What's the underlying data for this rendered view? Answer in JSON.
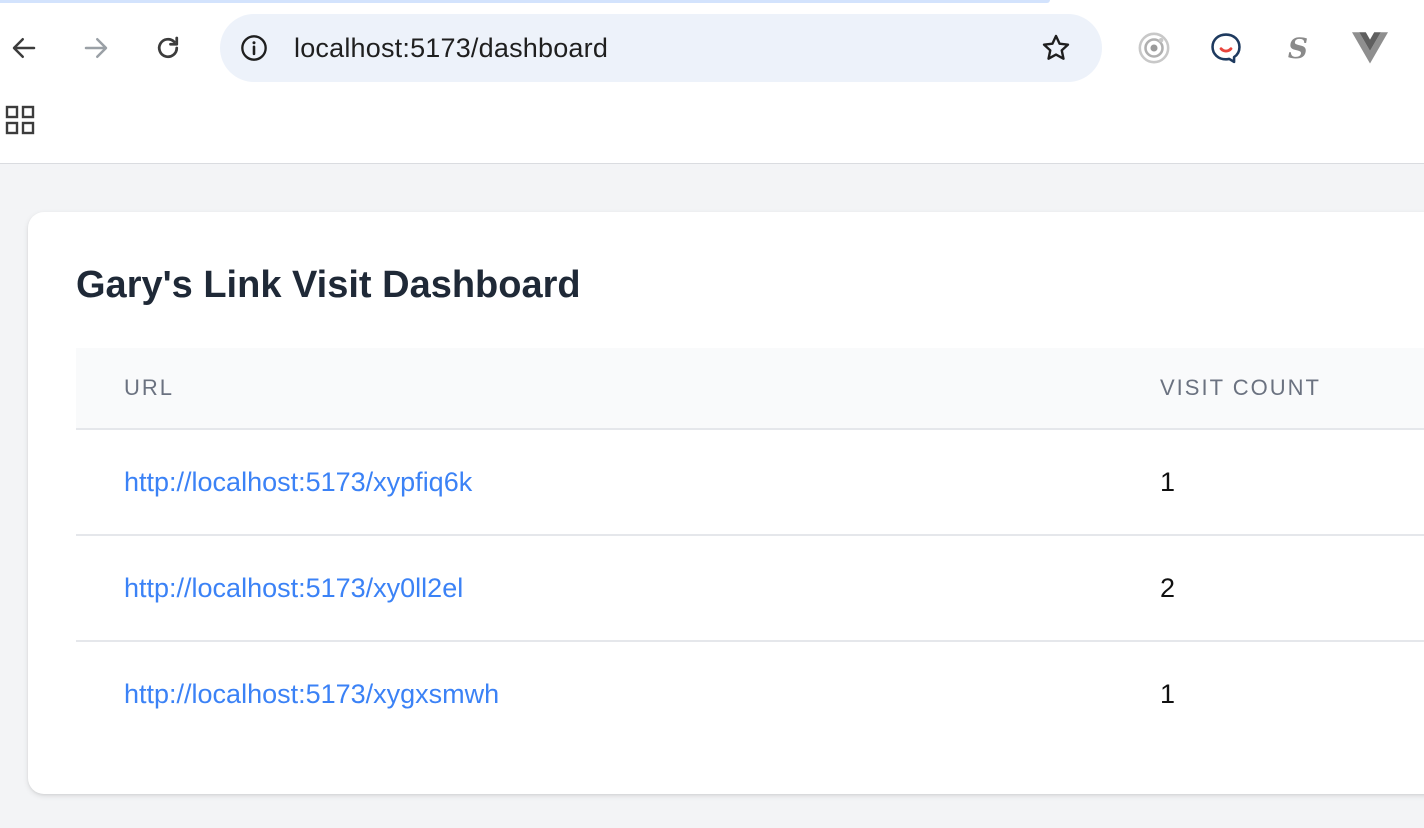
{
  "browser": {
    "url": "localhost:5173/dashboard",
    "icons": {
      "back": "back-arrow-icon",
      "forward": "forward-arrow-icon",
      "reload": "reload-icon",
      "site_info": "info-icon",
      "bookmark": "star-icon",
      "apps": "apps-grid-icon"
    },
    "extensions": [
      {
        "icon": "target-icon"
      },
      {
        "icon": "chat-bubble-icon"
      },
      {
        "icon": "s-letter-icon",
        "label": "S"
      },
      {
        "icon": "vue-devtools-icon"
      }
    ]
  },
  "page": {
    "title": "Gary's Link Visit Dashboard",
    "table": {
      "headers": {
        "url": "URL",
        "visit_count": "VISIT COUNT"
      },
      "rows": [
        {
          "url": "http://localhost:5173/xypfiq6k",
          "visits": "1"
        },
        {
          "url": "http://localhost:5173/xy0ll2el",
          "visits": "2"
        },
        {
          "url": "http://localhost:5173/xygxsmwh",
          "visits": "1"
        }
      ]
    }
  },
  "colors": {
    "link": "#3b82f6",
    "title": "#1f2937",
    "header_text": "#6b7280",
    "page_bg": "#f3f4f6",
    "omnibox_bg": "#edf2fa"
  }
}
